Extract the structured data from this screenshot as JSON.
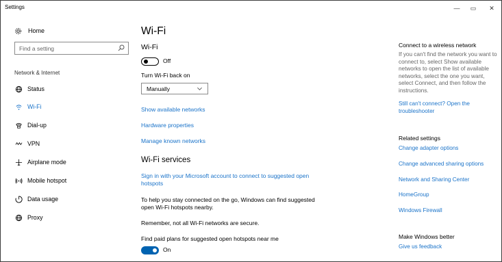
{
  "window": {
    "title": "Settings",
    "min": "—",
    "max": "▭",
    "close": "✕"
  },
  "sidebar": {
    "home_label": "Home",
    "search_placeholder": "Find a setting",
    "section": "Network & Internet",
    "items": [
      {
        "label": "Status",
        "icon": "globe-icon"
      },
      {
        "label": "Wi-Fi",
        "icon": "wifi-icon",
        "active": true
      },
      {
        "label": "Dial-up",
        "icon": "phone-icon"
      },
      {
        "label": "VPN",
        "icon": "vpn-icon"
      },
      {
        "label": "Airplane mode",
        "icon": "airplane-icon"
      },
      {
        "label": "Mobile hotspot",
        "icon": "hotspot-icon"
      },
      {
        "label": "Data usage",
        "icon": "data-usage-icon"
      },
      {
        "label": "Proxy",
        "icon": "globe-icon"
      }
    ]
  },
  "main": {
    "title": "Wi-Fi",
    "wifi_label": "Wi-Fi",
    "wifi_toggle_state": "Off",
    "turn_back_label": "Turn Wi-Fi back on",
    "turn_back_value": "Manually",
    "links": {
      "show_networks": "Show available networks",
      "hardware": "Hardware properties",
      "manage": "Manage known networks"
    },
    "services_title": "Wi-Fi services",
    "signin_link": "Sign in with your Microsoft account to connect to suggested open hotspots",
    "help_text": "To help you stay connected on the go, Windows can find suggested open Wi-Fi hotspots nearby.",
    "warning_text": "Remember, not all Wi-Fi networks are secure.",
    "paid_plans_label": "Find paid plans for suggested open hotspots near me",
    "paid_plans_state": "On"
  },
  "right": {
    "connect_heading": "Connect to a wireless network",
    "connect_text": "If you can't find the network you want to connect to, select Show available networks to open the list of available networks, select the one you want, select Connect, and then follow the instructions.",
    "troubleshoot_link": "Still can't connect? Open the troubleshooter",
    "related_heading": "Related settings",
    "related_links": [
      "Change adapter options",
      "Change advanced sharing options",
      "Network and Sharing Center",
      "HomeGroup",
      "Windows Firewall"
    ],
    "better_heading": "Make Windows better",
    "feedback_link": "Give us feedback"
  },
  "colors": {
    "accent": "#0063b1",
    "link": "#1a73c9"
  }
}
